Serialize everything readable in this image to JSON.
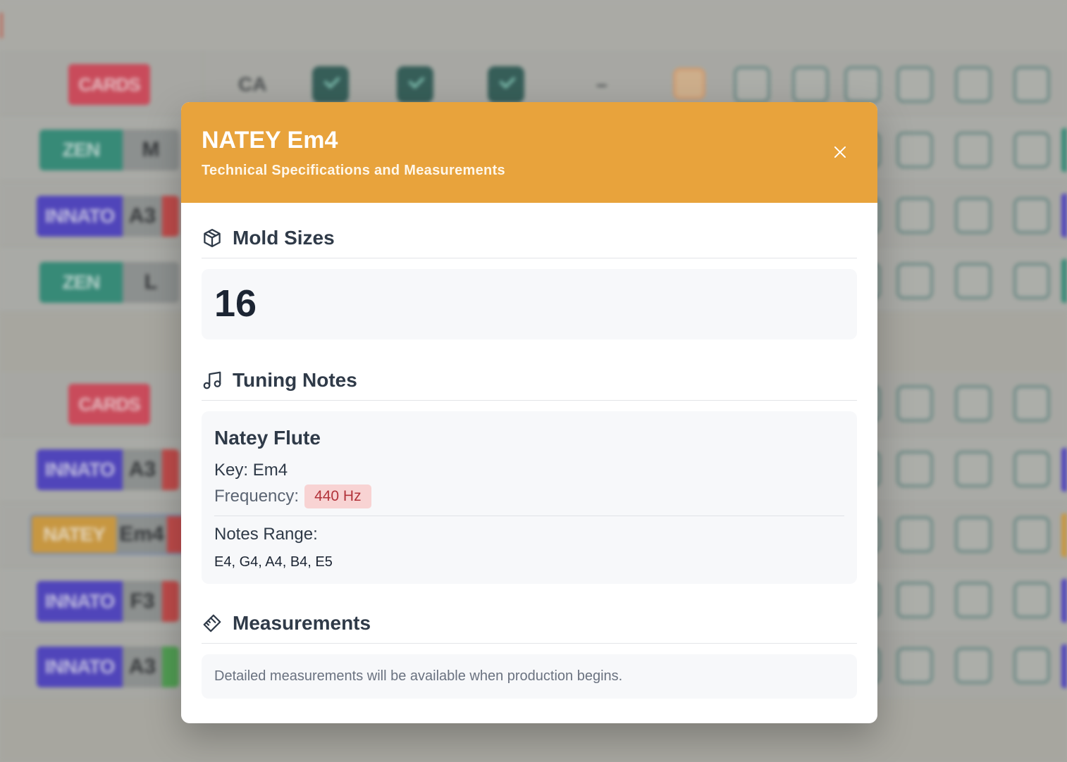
{
  "background": {
    "cards_label": "CARDS",
    "ca_label": "CA",
    "dash_label": "–",
    "warn_label": "!",
    "rows": [
      {
        "brand": "ZEN",
        "size": "M",
        "color": "#2e8c78"
      },
      {
        "brand": "INNATO",
        "size": "A3",
        "color": "#4b3ec4"
      },
      {
        "brand": "ZEN",
        "size": "L",
        "color": "#2e8c78"
      },
      {
        "brand": "INNATO",
        "size": "A3",
        "color": "#4b3ec4"
      },
      {
        "brand": "NATEY",
        "size": "Em4",
        "color": "#d29b3b"
      },
      {
        "brand": "INNATO",
        "size": "F3",
        "color": "#4b3ec4"
      },
      {
        "brand": "INNATO",
        "size": "A3",
        "color": "#4b3ec4"
      }
    ]
  },
  "modal": {
    "title": "NATEY Em4",
    "subtitle": "Technical Specifications and Measurements",
    "header_color": "#e8a33c",
    "mold_sizes": {
      "heading": "Mold Sizes",
      "icon": "cube-icon",
      "value": "16"
    },
    "tuning_notes": {
      "heading": "Tuning Notes",
      "icon": "music-note-icon",
      "instrument": "Natey Flute",
      "key_text": "Key: Em4",
      "frequency_label": "Frequency:",
      "frequency_value": "440 Hz",
      "range_label": "Notes Range:",
      "range_value": "E4, G4, A4, B4, E5"
    },
    "measurements": {
      "heading": "Measurements",
      "icon": "ruler-icon",
      "text": "Detailed measurements will be available when production begins."
    }
  }
}
